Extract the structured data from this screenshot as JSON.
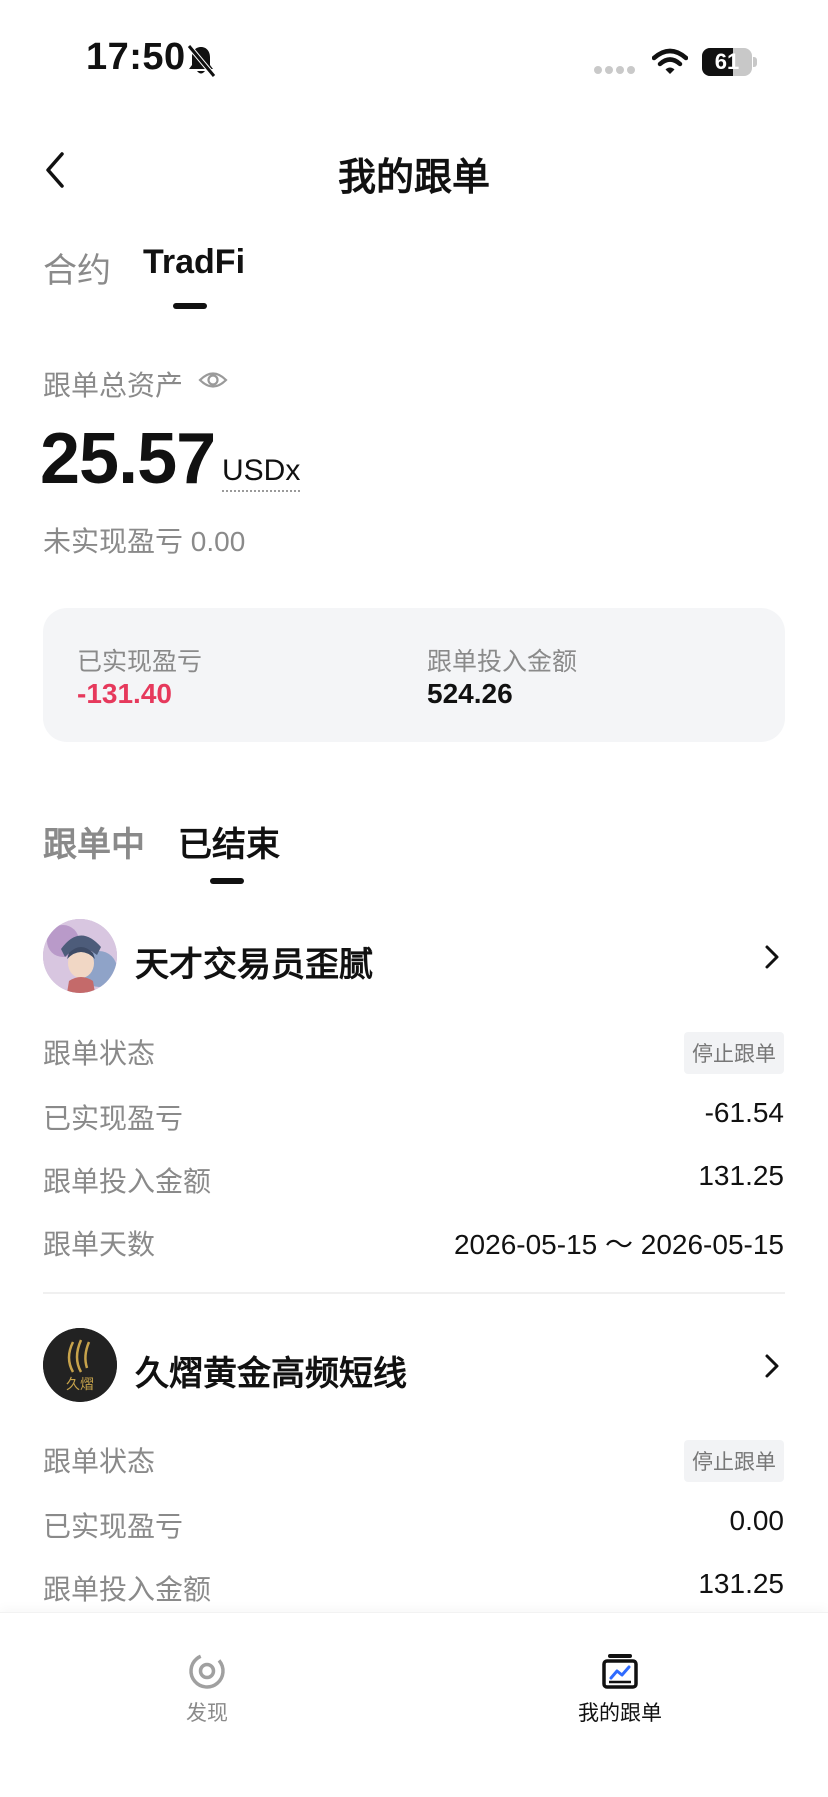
{
  "status_bar": {
    "time": "17:50",
    "battery": "61",
    "battery_level": 0.61
  },
  "header": {
    "title": "我的跟单"
  },
  "top_tabs": [
    {
      "label": "合约"
    },
    {
      "label": "TradFi"
    }
  ],
  "assets": {
    "label": "跟单总资产",
    "value": "25.57",
    "unit": "USDx",
    "unrealized": "未实现盈亏 0.00"
  },
  "summary": {
    "realized_label": "已实现盈亏",
    "realized_value": "-131.40",
    "invested_label": "跟单投入金额",
    "invested_value": "524.26"
  },
  "section_tabs": [
    {
      "label": "跟单中"
    },
    {
      "label": "已结束"
    }
  ],
  "traders": [
    {
      "name": "天才交易员歪腻",
      "status_label": "跟单状态",
      "status_value": "停止跟单",
      "pnl_label": "已实现盈亏",
      "pnl_value": "-61.54",
      "invest_label": "跟单投入金额",
      "invest_value": "131.25",
      "days_label": "跟单天数",
      "days_value": "2026-05-15 ～ 2026-05-15"
    },
    {
      "name": "久熠黄金高频短线",
      "avatar_text": "久熠",
      "status_label": "跟单状态",
      "status_value": "停止跟单",
      "pnl_label": "已实现盈亏",
      "pnl_value": "0.00",
      "invest_label": "跟单投入金额",
      "invest_value": "131.25"
    }
  ],
  "bottom_nav": [
    {
      "label": "发现",
      "icon": "discover-icon"
    },
    {
      "label": "我的跟单",
      "icon": "my-copy-trading-icon"
    }
  ],
  "colors": {
    "loss_red": "#e6395c",
    "card_bg": "#f4f5f7",
    "muted": "#8a8a8a"
  }
}
